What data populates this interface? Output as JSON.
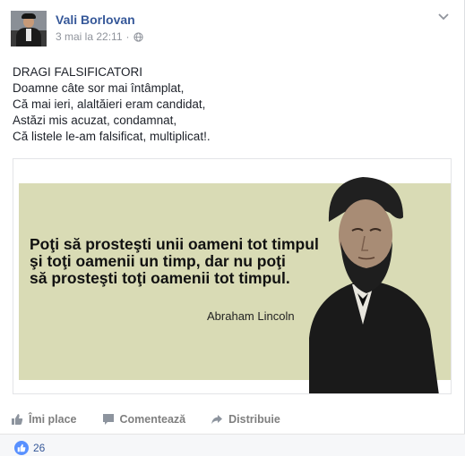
{
  "post": {
    "author": "Vali Borlovan",
    "timestamp": "3 mai la 22:11",
    "separator": "·",
    "audience_icon": "globe-icon",
    "menu_icon": "chevron-down-icon",
    "text_lines": [
      "DRAGI FALSIFICATORI",
      "Doamne câte sor mai întâmplat,",
      "Că mai ieri, alaltăieri eram candidat,",
      "Astăzi mis acuzat, condamnat,",
      "Că listele le-am falsificat, multiplicat!."
    ]
  },
  "image": {
    "quote_lines": [
      "Poţi să prosteşti unii oameni tot timpul",
      "şi toţi oamenii un timp, dar nu poţi",
      "să prosteşti toţi oamenii tot timpul."
    ],
    "quote_author": "Abraham Lincoln"
  },
  "actions": {
    "like_label": "Îmi place",
    "comment_label": "Comentează",
    "share_label": "Distribuie"
  },
  "reactions": {
    "count": "26"
  },
  "colors": {
    "link": "#365899",
    "banner": "#d9dbb5",
    "like_badge": "#5890ff"
  }
}
